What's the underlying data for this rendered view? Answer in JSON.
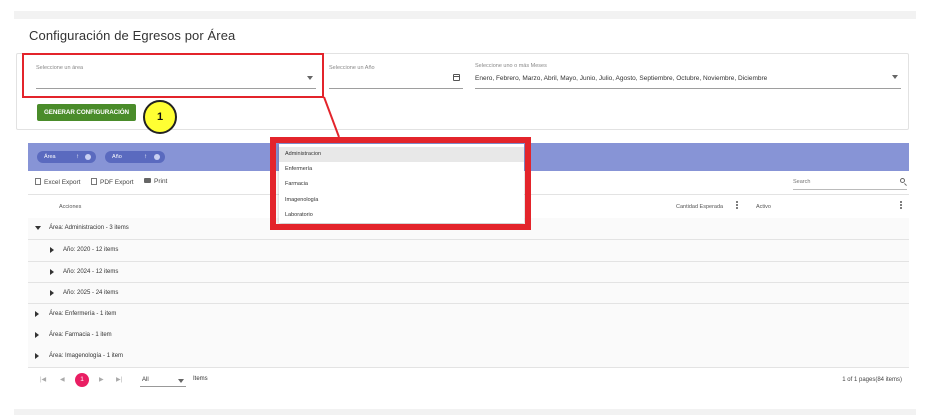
{
  "page_title": "Configuración de Egresos por Área",
  "filters": {
    "area": {
      "label": "Seleccione un área",
      "value": ""
    },
    "year": {
      "label": "Seleccione un Año",
      "value": ""
    },
    "months": {
      "label": "Seleccione uno o más Meses",
      "value": "Enero, Febrero, Marzo, Abril, Mayo, Junio, Julio, Agosto, Septiembre, Octubre, Noviembre, Diciembre"
    },
    "generate_button": "GENERAR CONFIGURACIÓN"
  },
  "annotation_badge": "1",
  "group_chips": [
    {
      "label": "Área",
      "arrow": "↑"
    },
    {
      "label": "Año",
      "arrow": "↑"
    }
  ],
  "toolbar": {
    "excel_export": "Excel Export",
    "pdf_export": "PDF Export",
    "print": "Print",
    "search_placeholder": "Search"
  },
  "columns": {
    "acciones": "Acciones",
    "cantidad_esperada": "Cantidad Esperada",
    "activo": "Activo"
  },
  "rows": [
    {
      "label": "Área: Administracion - 3 items",
      "expanded": true,
      "level": 0
    },
    {
      "label": "Año: 2020 - 12 items",
      "expanded": false,
      "level": 1
    },
    {
      "label": "Año: 2024 - 12 items",
      "expanded": false,
      "level": 1
    },
    {
      "label": "Año: 2025 - 24 items",
      "expanded": false,
      "level": 1
    },
    {
      "label": "Área: Enfermería - 1 item",
      "expanded": false,
      "level": 0
    },
    {
      "label": "Área: Farmacia - 1 item",
      "expanded": false,
      "level": 0
    },
    {
      "label": "Área: Imagenología - 1 item",
      "expanded": false,
      "level": 0
    }
  ],
  "pager": {
    "first": "|◀",
    "prev": "◀",
    "current_page": "1",
    "next": "▶",
    "last": "▶|",
    "page_size": "All",
    "items_label": "Items",
    "info": "1 of 1 pages(84 items)"
  },
  "dropdown_options": [
    {
      "label": "Administracion",
      "selected": true
    },
    {
      "label": "Enfermería",
      "selected": false
    },
    {
      "label": "Farmacia",
      "selected": false
    },
    {
      "label": "Imagenología",
      "selected": false
    },
    {
      "label": "Laboratorio",
      "selected": false
    }
  ],
  "colors": {
    "annotation_red": "#e3242b",
    "badge_yellow": "#ffff33",
    "generate_green": "#4a8c2a",
    "group_bar": "#8794d6",
    "chip": "#5a6abf",
    "pager_active": "#e91e63"
  }
}
